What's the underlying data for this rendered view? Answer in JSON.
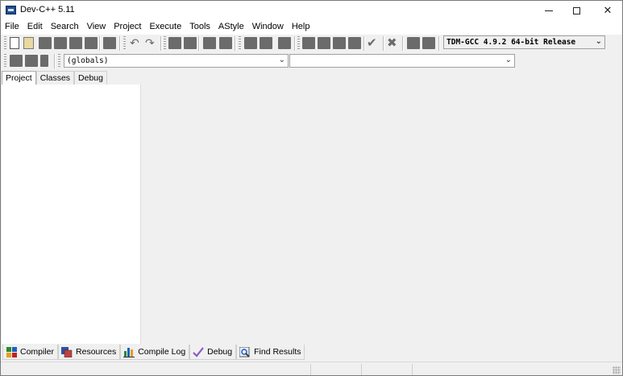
{
  "window": {
    "title": "Dev-C++ 5.11",
    "controls": {
      "minimize": "–",
      "maximize": "□",
      "close": "✕"
    }
  },
  "menubar": {
    "items": [
      "File",
      "Edit",
      "Search",
      "View",
      "Project",
      "Execute",
      "Tools",
      "AStyle",
      "Window",
      "Help"
    ]
  },
  "toolbar": {
    "compiler_select": "TDM-GCC 4.9.2 64-bit Release",
    "class_select": "(globals)",
    "member_select": "",
    "icons": [
      "new-file-icon",
      "open-file-icon",
      "save-icon",
      "save-all-icon",
      "close-icon",
      "close-all-icon",
      "print-icon",
      "undo-icon",
      "redo-icon",
      "find-icon",
      "replace-icon",
      "indent-icon",
      "unindent-icon",
      "goto-icon",
      "bookmark-icon",
      "compile-icon",
      "run-icon",
      "compile-run-icon",
      "rebuild-icon",
      "check-icon",
      "stop-icon",
      "profile-icon",
      "debug-icon"
    ]
  },
  "left_tabs": [
    "Project",
    "Classes",
    "Debug"
  ],
  "bottom_tabs": [
    "Compiler",
    "Resources",
    "Compile Log",
    "Debug",
    "Find Results"
  ],
  "colors": {
    "accent": "#1f4e8c",
    "toolbar_icon": "#6b6b6b",
    "check": "#6b6b6b"
  }
}
